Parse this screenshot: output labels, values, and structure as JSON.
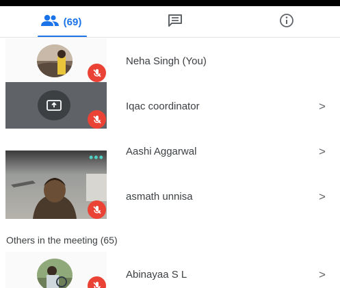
{
  "tabs": {
    "people_count": "(69)",
    "people_icon": "people-icon",
    "chat_icon": "chat-icon",
    "info_icon": "info-icon"
  },
  "participants": [
    {
      "name": "Neha Singh (You)",
      "muted": true,
      "tile": "avatar"
    },
    {
      "name": "Iqac coordinator",
      "muted": true,
      "tile": "presenting",
      "chevron": ">"
    },
    {
      "name": "Aashi Aggarwal",
      "chevron": ">"
    },
    {
      "name": "asmath unnisa",
      "muted": true,
      "tile": "video",
      "chevron": ">"
    }
  ],
  "others_section": {
    "label": "Others in the meeting (65)",
    "participants": [
      {
        "name": "Abinayaa S L",
        "muted": true,
        "tile": "avatar",
        "chevron": ">"
      }
    ]
  },
  "colors": {
    "accent": "#1a73e8",
    "mic_off": "#ea4335",
    "tile_bg": "#5f6368"
  }
}
